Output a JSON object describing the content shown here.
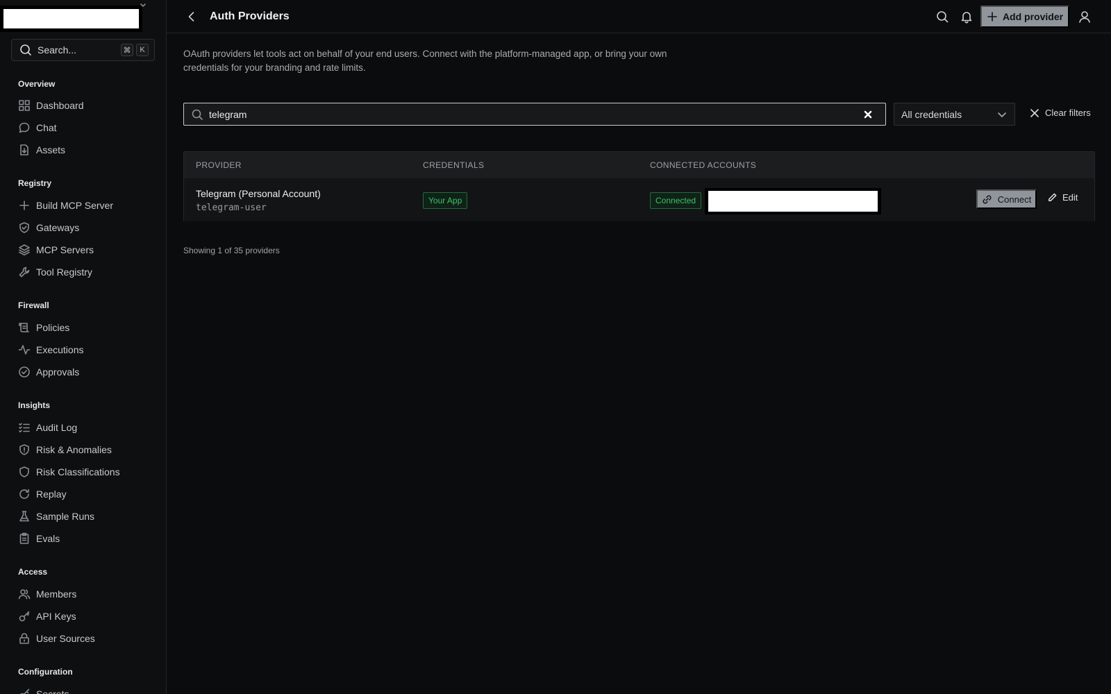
{
  "sidebar": {
    "search": {
      "label": "Search...",
      "kbd": [
        "⌘",
        "K"
      ]
    },
    "sections": [
      {
        "title": "Overview",
        "items": [
          {
            "label": "Dashboard",
            "icon": "grid-icon"
          },
          {
            "label": "Chat",
            "icon": "chat-bubble-icon"
          },
          {
            "label": "Assets",
            "icon": "file-download-icon"
          }
        ]
      },
      {
        "title": "Registry",
        "items": [
          {
            "label": "Build MCP Server",
            "icon": "plus-icon"
          },
          {
            "label": "Gateways",
            "icon": "shield-check-icon"
          },
          {
            "label": "MCP Servers",
            "icon": "layers-icon"
          },
          {
            "label": "Tool Registry",
            "icon": "wrench-icon"
          }
        ]
      },
      {
        "title": "Firewall",
        "items": [
          {
            "label": "Policies",
            "icon": "scroll-icon"
          },
          {
            "label": "Executions",
            "icon": "activity-icon"
          },
          {
            "label": "Approvals",
            "icon": "check-circle-icon"
          }
        ]
      },
      {
        "title": "Insights",
        "items": [
          {
            "label": "Audit Log",
            "icon": "list-check-icon"
          },
          {
            "label": "Risk & Anomalies",
            "icon": "shield-alert-icon"
          },
          {
            "label": "Risk Classifications",
            "icon": "shield-icon"
          },
          {
            "label": "Replay",
            "icon": "rotate-icon"
          },
          {
            "label": "Sample Runs",
            "icon": "flask-icon"
          },
          {
            "label": "Evals",
            "icon": "clipboard-icon"
          }
        ]
      },
      {
        "title": "Access",
        "items": [
          {
            "label": "Members",
            "icon": "users-icon"
          },
          {
            "label": "API Keys",
            "icon": "key-icon"
          },
          {
            "label": "User Sources",
            "icon": "lock-icon"
          }
        ]
      },
      {
        "title": "Configuration",
        "items": [
          {
            "label": "Secrets",
            "icon": "key-icon"
          }
        ]
      }
    ]
  },
  "header": {
    "title": "Auth Providers",
    "add_provider_label": "Add provider"
  },
  "intro": "OAuth providers let tools act on behalf of your end users. Connect with the platform-managed app, or bring your own credentials for your branding and rate limits.",
  "filters": {
    "search_value": "telegram",
    "credentials_select": "All credentials",
    "clear_label": "Clear filters"
  },
  "table": {
    "columns": [
      "PROVIDER",
      "CREDENTIALS",
      "CONNECTED ACCOUNTS"
    ],
    "rows": [
      {
        "name": "Telegram (Personal Account)",
        "id": "telegram-user",
        "credentials": "Your App",
        "status": "Connected",
        "connect_label": "Connect",
        "edit_label": "Edit"
      }
    ]
  },
  "footer": {
    "showing": "Showing 1 of 35 providers"
  }
}
